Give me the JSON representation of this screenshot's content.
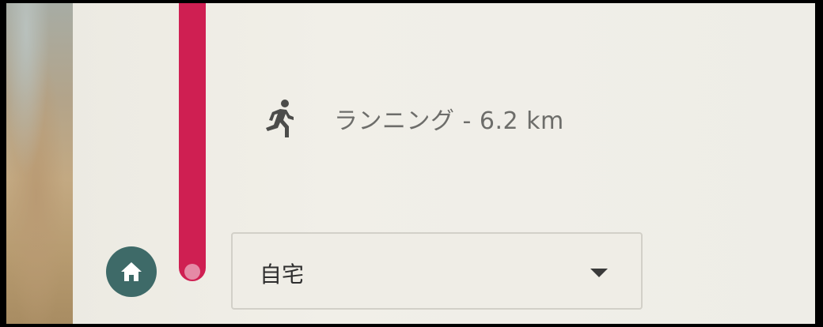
{
  "timeline": {
    "activity": {
      "icon": "running-icon",
      "label": "ランニング - 6.2 km"
    },
    "place": {
      "icon": "home-icon",
      "selected_value": "自宅",
      "dropdown_icon": "dropdown-arrow-icon"
    }
  },
  "colors": {
    "timeline_line": "#cf1f52",
    "timeline_dot": "#e58aa6",
    "home_button": "#3e6a68",
    "text_muted": "#6d6d6a",
    "text_primary": "#2f2f2f"
  }
}
